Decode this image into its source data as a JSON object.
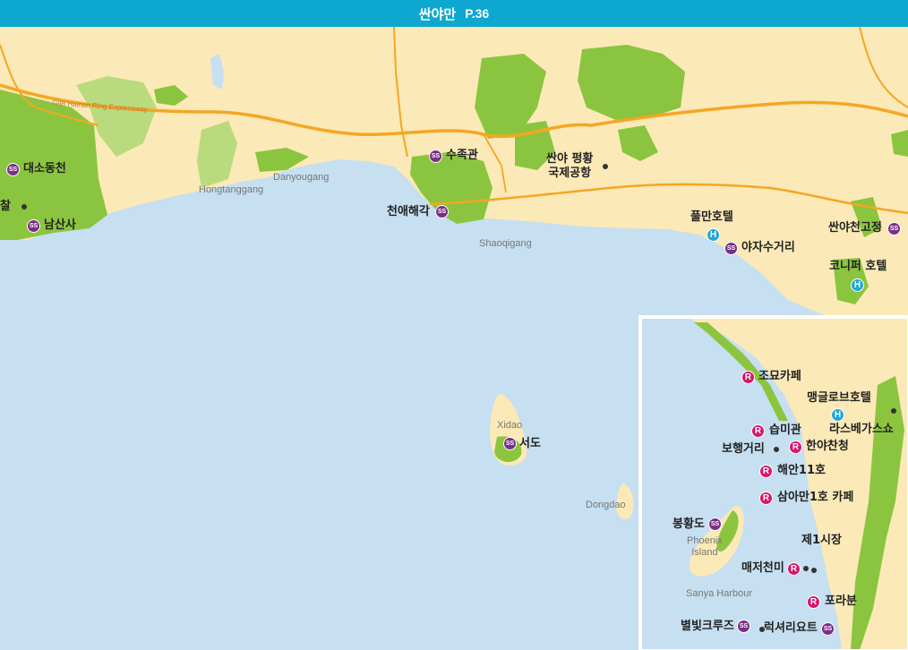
{
  "header": {
    "title": "싼야만",
    "page_ref": "P.36",
    "color": "#0da7cf"
  },
  "colors": {
    "sea": "#c6dff1",
    "land": "#fbe9b7",
    "park": "#8bc53f",
    "road_major": "#f5a623"
  },
  "roads": {
    "expressway": "G98 Hainan Ring Expressway"
  },
  "places": {
    "hongtanggang": "Hongtanggang",
    "danyougang": "Danyougang",
    "shaoqigang": "Shaoqigang",
    "xidao": "Xidao",
    "dongdao": "Dongdao",
    "phoenix_island": "Phoenix\nIsland",
    "sanya_harbour": "Sanya Harbour"
  },
  "labels": {
    "dasodongcheon": "대소동천",
    "chal": "찰",
    "namsansa": "남산사",
    "sujokgwan": "수족관",
    "airport": "싼야 펑황\n국제공항",
    "cheonaehaegak": "천애해각",
    "pullman": "풀만호텔",
    "yajasugeori": "야자수거리",
    "sanya_cheongojeong": "싼야천고정",
    "conifer_hotel": "코니퍼 호텔",
    "seodo": "서도",
    "jomyo_cafe": "조묘카페",
    "mangrove_hotel": "맹글로브호텔",
    "seupmigwan": "습미관",
    "lasvegas_show": "라스베가스쇼",
    "pedestrian_street": "보행거리",
    "hanyachancheong": "한야찬청",
    "haean11": "해안11호",
    "sanyaman1_cafe": "삼아만1호 카페",
    "bonghwangdo": "봉황도",
    "jeil_market": "제1시장",
    "maejeocheonmi": "매저천미",
    "porabun": "포라분",
    "byeolbit_cruise": "별빛크루즈",
    "luxury_yacht": "럭셔리요트"
  },
  "icons": {
    "ss": "SS",
    "r": "R",
    "h": "H"
  }
}
